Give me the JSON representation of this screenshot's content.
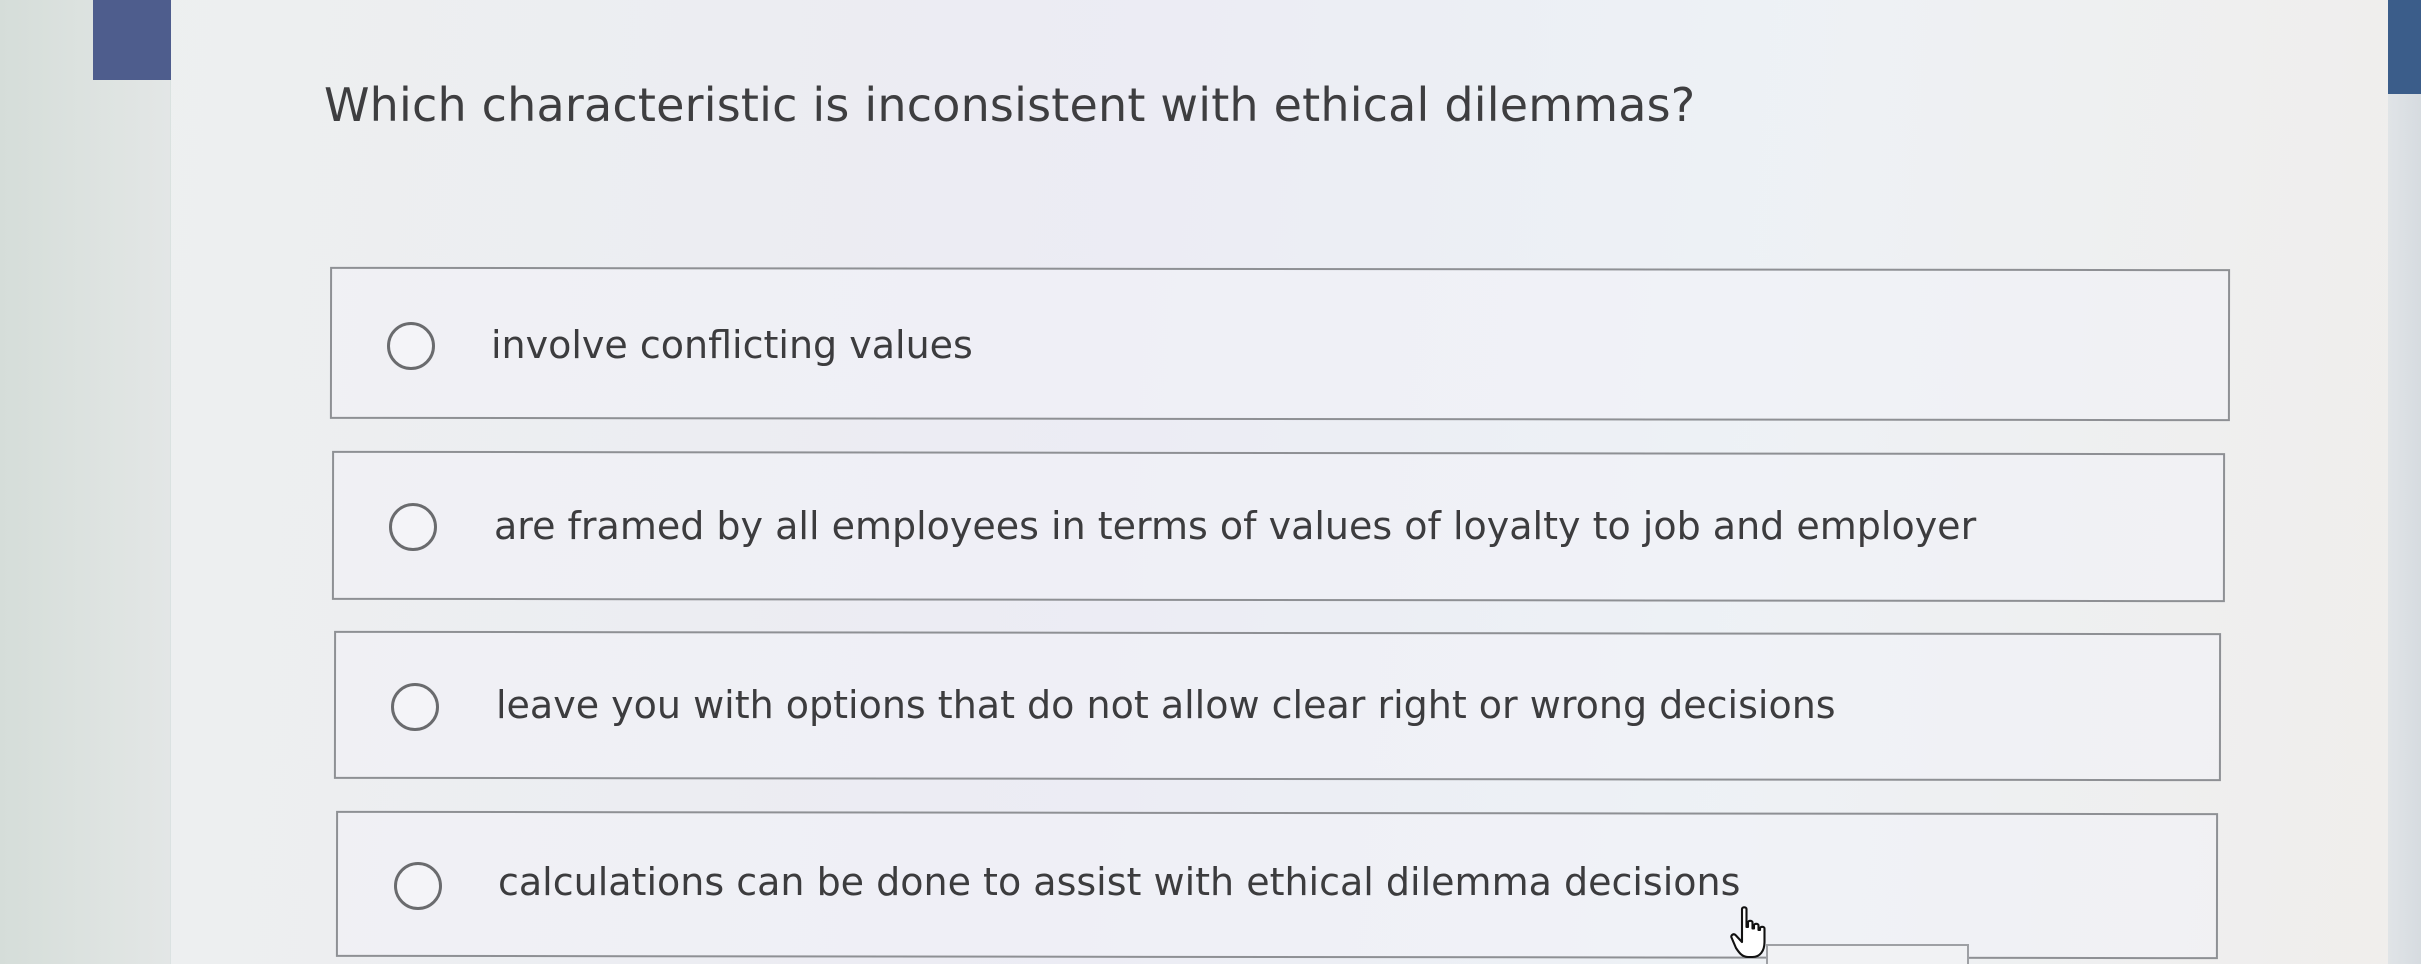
{
  "question": {
    "text": "Which characteristic is inconsistent with ethical dilemmas?"
  },
  "options": [
    {
      "label": "involve conflicting values",
      "selected": false
    },
    {
      "label": "are framed by all employees in terms of values of loyalty to job and employer",
      "selected": false
    },
    {
      "label": "leave you with options that do not allow clear right or wrong decisions",
      "selected": false
    },
    {
      "label": "calculations can be done to assist with ethical dilemma decisions",
      "selected": false
    }
  ],
  "cursor": {
    "icon": "hand-pointer-icon"
  },
  "colors": {
    "accent_left": "#4e5d8d",
    "accent_right": "#3b5d8a",
    "text": "#3e3e40",
    "border": "#8e9094"
  }
}
